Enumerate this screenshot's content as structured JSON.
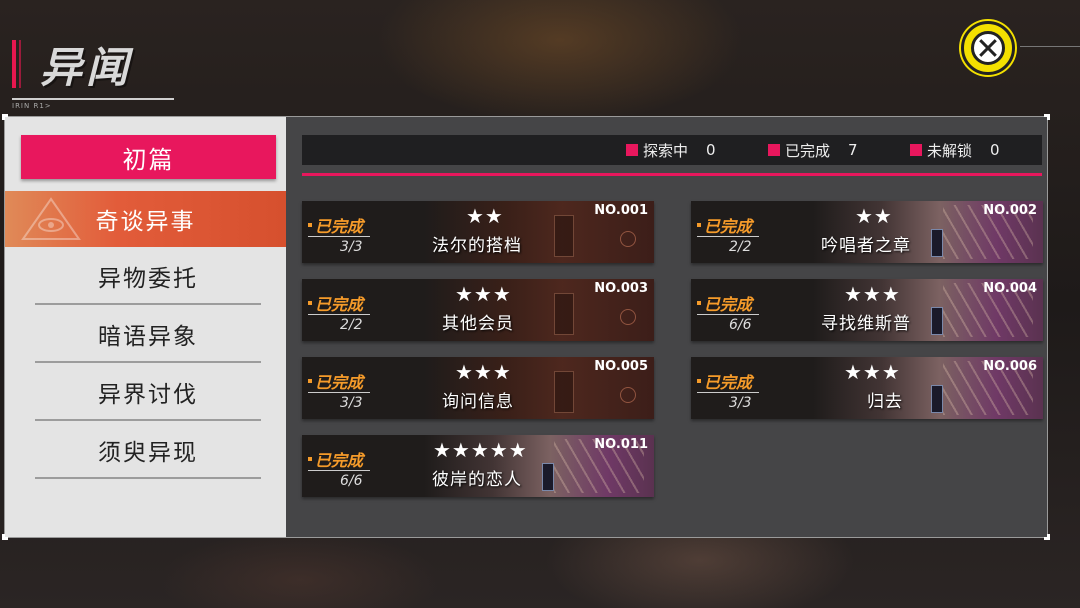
{
  "header": {
    "title": "异闻",
    "subtitle_code": "IRIN R1>"
  },
  "close_icon": "close-x-icon",
  "sidebar": {
    "chapter": "初篇",
    "items": [
      {
        "label": "奇谈异事",
        "active": true
      },
      {
        "label": "异物委托",
        "active": false
      },
      {
        "label": "暗语异象",
        "active": false
      },
      {
        "label": "异界讨伐",
        "active": false
      },
      {
        "label": "须臾异现",
        "active": false
      }
    ]
  },
  "stats": {
    "exploring_label": "探索中",
    "exploring_value": "0",
    "completed_label": "已完成",
    "completed_value": "7",
    "locked_label": "未解锁",
    "locked_value": "0"
  },
  "colors": {
    "accent": "#e8175d",
    "status": "#f59b2a",
    "active_tab": "#e25c3a",
    "close_button": "#f3e000"
  },
  "cards": [
    {
      "no": "NO.001",
      "status": "已完成",
      "progress": "3/3",
      "stars": "★★",
      "title": "法尔的搭档",
      "rating": 2
    },
    {
      "no": "NO.002",
      "status": "已完成",
      "progress": "2/2",
      "stars": "★★",
      "title": "吟唱者之章",
      "rating": 2
    },
    {
      "no": "NO.003",
      "status": "已完成",
      "progress": "2/2",
      "stars": "★★★",
      "title": "其他会员",
      "rating": 3
    },
    {
      "no": "NO.004",
      "status": "已完成",
      "progress": "6/6",
      "stars": "★★★",
      "title": "寻找维斯普",
      "rating": 3
    },
    {
      "no": "NO.005",
      "status": "已完成",
      "progress": "3/3",
      "stars": "★★★",
      "title": "询问信息",
      "rating": 3
    },
    {
      "no": "NO.006",
      "status": "已完成",
      "progress": "3/3",
      "stars": "★★★",
      "title": "归去",
      "rating": 3
    },
    {
      "no": "NO.011",
      "status": "已完成",
      "progress": "6/6",
      "stars": "★★★★★",
      "title": "彼岸的恋人",
      "rating": 5
    }
  ]
}
